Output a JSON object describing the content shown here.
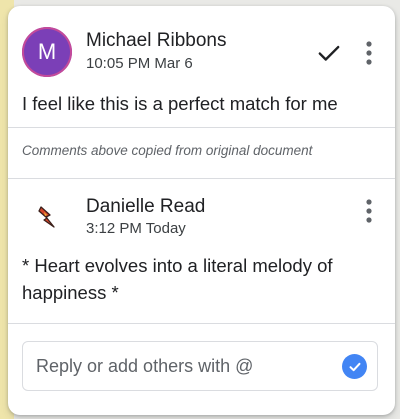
{
  "comment": {
    "author": {
      "name": "Michael Ribbons",
      "initial": "M",
      "avatar_color": "#7b3fb7"
    },
    "timestamp": "10:05 PM Mar 6",
    "text": "I feel like this is a perfect match for me",
    "resolve_icon": "checkmark-icon",
    "more_icon": "more-vertical-icon"
  },
  "copied_note": "Comments above copied from original document",
  "reply": {
    "author": {
      "name": "Danielle Read",
      "avatar_icon": "lightning-avatar-icon"
    },
    "timestamp": "3:12 PM Today",
    "text": "* Heart evolves into a literal melody of happiness *",
    "more_icon": "more-vertical-icon"
  },
  "reply_box": {
    "placeholder": "Reply or add others with @",
    "submit_icon": "check-circle-icon",
    "accent": "#4285f4"
  }
}
